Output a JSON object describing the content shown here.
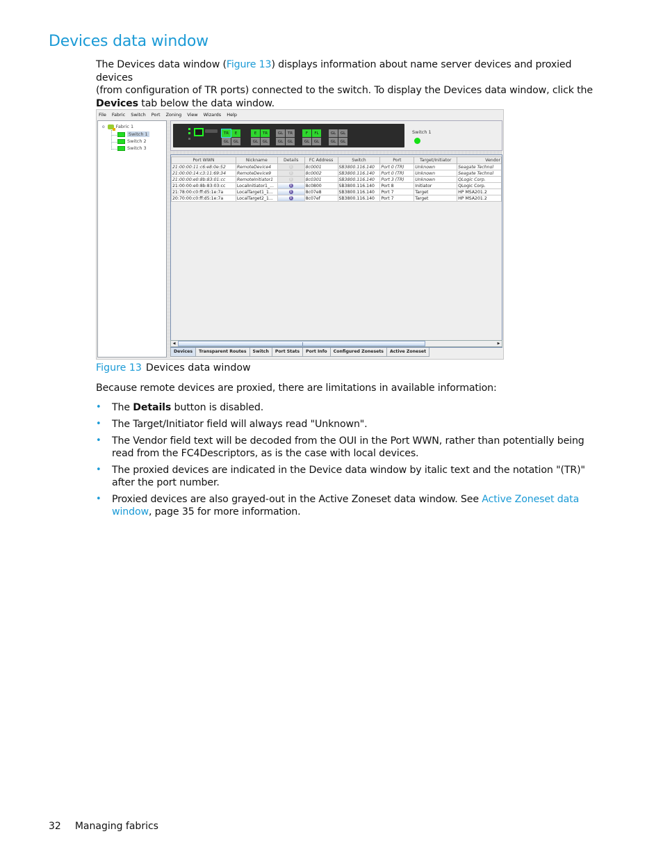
{
  "heading": "Devices data window",
  "intro": {
    "part1": "The Devices data window (",
    "figure_link": "Figure 13",
    "part2": ") displays information about name server devices and proxied devices",
    "line2": "(from configuration of TR ports) connected to the switch. To display the Devices data window, click the",
    "bold": "Devices",
    "line3": " tab below the data window."
  },
  "screenshot": {
    "menu": [
      "File",
      "Fabric",
      "Switch",
      "Port",
      "Zoning",
      "View",
      "Wizards",
      "Help"
    ],
    "tree": {
      "root": "Fabric 1",
      "switches": [
        "Switch 1",
        "Switch 2",
        "Switch 3"
      ],
      "selected": "Switch 1"
    },
    "faceplate": {
      "port_groups": [
        {
          "top": [
            "TR",
            "E"
          ],
          "bottom": [
            "GL",
            "GL"
          ],
          "green": [
            true,
            true
          ]
        },
        {
          "top": [
            "E",
            "TR"
          ],
          "bottom": [
            "GL",
            "GL"
          ],
          "green": [
            true,
            true
          ]
        },
        {
          "top": [
            "GL",
            "TR"
          ],
          "bottom": [
            "GL",
            "GL"
          ],
          "green": [
            false,
            false
          ]
        },
        {
          "top": [
            "F",
            "FL"
          ],
          "bottom": [
            "GL",
            "GL"
          ],
          "green": [
            true,
            true
          ]
        },
        {
          "top": [
            "GL",
            "GL"
          ],
          "bottom": [
            "GL",
            "GL"
          ],
          "green": [
            false,
            false
          ]
        }
      ],
      "switch_label": "Switch 1",
      "status_color": "#15e015"
    },
    "table": {
      "columns": [
        "Port WWN",
        "Nickname",
        "Details",
        "FC Address",
        "Switch",
        "Port",
        "Target/Initiator",
        "Vendor"
      ],
      "rows": [
        {
          "wwn": "21:00:00:11:c6:e8:0e:52",
          "nickname": "RemoteDevice4",
          "details_enabled": false,
          "fc": "8c0001",
          "switch": "SB3800.116.140",
          "port": "Port 0 (TR)",
          "ti": "Unknown",
          "vendor": "Seagate Technol",
          "proxied": true
        },
        {
          "wwn": "21:00:00:14:c3:11:69:34",
          "nickname": "RemoteDevice9",
          "details_enabled": false,
          "fc": "8c0002",
          "switch": "SB3800.116.140",
          "port": "Port 0 (TR)",
          "ti": "Unknown",
          "vendor": "Seagate Technol",
          "proxied": true
        },
        {
          "wwn": "21:00:00:e0:8b:83:01:cc",
          "nickname": "RemoteInitiator1",
          "details_enabled": false,
          "fc": "8c0301",
          "switch": "SB3800.116.140",
          "port": "Port 3 (TR)",
          "ti": "Unknown",
          "vendor": "QLogic Corp.",
          "proxied": true
        },
        {
          "wwn": "21:00:00:e0:8b:83:03:cc",
          "nickname": "LocalInitiator1_...",
          "details_enabled": true,
          "fc": "8c0800",
          "switch": "SB3800.116.140",
          "port": "Port 8",
          "ti": "Initiator",
          "vendor": "QLogic Corp.",
          "proxied": false
        },
        {
          "wwn": "21:78:00:c0:ff:d5:1e:7a",
          "nickname": "LocalTarget1_1...",
          "details_enabled": true,
          "fc": "8c07e8",
          "switch": "SB3800.116.140",
          "port": "Port 7",
          "ti": "Target",
          "vendor": "HP       MSA201.2",
          "proxied": false
        },
        {
          "wwn": "20:70:00:c0:ff:d5:1e:7a",
          "nickname": "LocalTarget2_1...",
          "details_enabled": true,
          "fc": "8c07ef",
          "switch": "SB3800.116.140",
          "port": "Port 7",
          "ti": "Target",
          "vendor": "HP       MSA201.2",
          "proxied": false
        }
      ]
    },
    "tabs": [
      "Devices",
      "Transparent Routes",
      "Switch",
      "Port Stats",
      "Port Info",
      "Configured Zonesets",
      "Active Zoneset"
    ],
    "active_tab": "Devices"
  },
  "caption": {
    "figure": "Figure 13",
    "text": "Devices data window"
  },
  "limitations_intro": "Because remote devices are proxied,  there are limitations in available information:",
  "bullets": {
    "b1_pre": "The ",
    "b1_bold": "Details",
    "b1_post": " button is disabled.",
    "b2": "The Target/Initiator field will always read \"Unknown\".",
    "b3": "The Vendor field text will be decoded from the OUI in the Port WWN, rather than potentially being read from the FC4Descriptors, as is the case with local devices.",
    "b4": "The proxied devices are indicated in the Device data window by italic text and the notation \"(TR)\" after the port number.",
    "b5_pre": "Proxied devices are also grayed-out in the Active Zoneset data window. See ",
    "b5_link": "Active Zoneset data window",
    "b5_post": ", page 35 for more information."
  },
  "footer": {
    "page": "32",
    "section": "Managing fabrics"
  }
}
